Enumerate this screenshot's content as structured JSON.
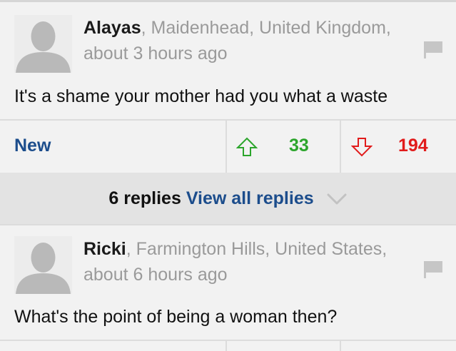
{
  "comments": [
    {
      "username": "Alayas",
      "location": ", Maidenhead, United Kingdom,",
      "time": "about 3 hours ago",
      "text": "It's a shame your mother had you what a waste",
      "new_label": "New",
      "upvotes": "33",
      "downvotes": "194",
      "replies_count": "6 replies",
      "replies_link": "View all replies"
    },
    {
      "username": "Ricki",
      "location": ", Farmington Hills, United States,",
      "time": "about 6 hours ago",
      "text": "What's the point of being a woman then?"
    }
  ],
  "icons": {
    "avatar": "avatar-placeholder",
    "flag": "flag-icon",
    "upvote": "up-arrow-icon",
    "downvote": "down-arrow-icon",
    "chevron": "chevron-down-icon"
  },
  "colors": {
    "link_blue": "#1c4d8c",
    "up_green": "#2ca52c",
    "down_red": "#e11b1b",
    "meta_gray": "#9a9a9a"
  }
}
